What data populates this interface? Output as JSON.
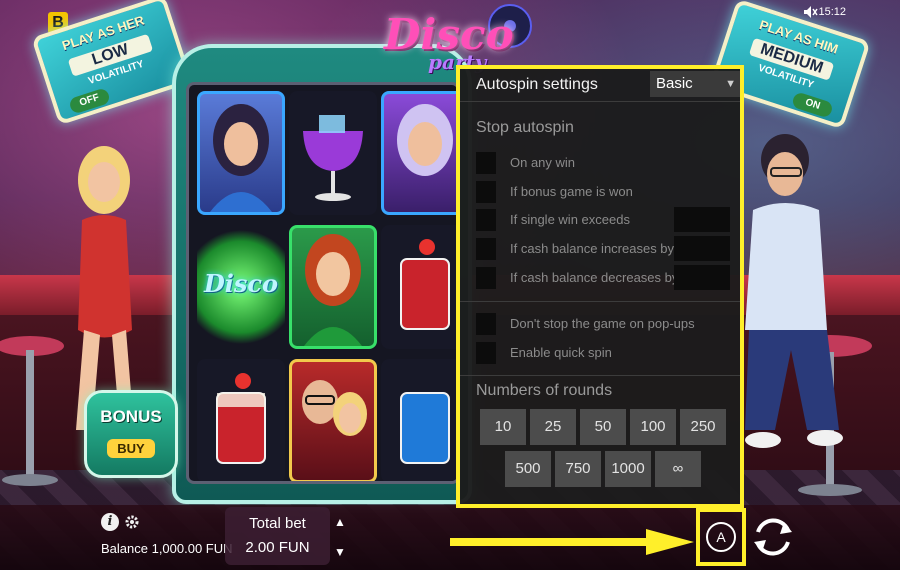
{
  "brand": {
    "badge": "B"
  },
  "status_bar": {
    "time": "15:12",
    "speaker_icon": "speaker-muted-icon"
  },
  "logo": {
    "title": "Disco",
    "subtitle": "party"
  },
  "banner_left": {
    "top": "PLAY AS HER",
    "volatility": "LOW",
    "sub": "VOLATILITY",
    "toggle": "OFF"
  },
  "banner_right": {
    "top": "PLAY AS HIM",
    "volatility": "MEDIUM",
    "sub": "VOLATILITY",
    "toggle": "ON"
  },
  "reels": {
    "disco_symbol": "Disco"
  },
  "bonus_buy": {
    "line1": "BONUS",
    "line2": "BUY"
  },
  "footer": {
    "info_icon": "i",
    "balance": "Balance 1,000.00 FUN",
    "total_bet_label": "Total bet",
    "total_bet_value": "2.00 FUN",
    "bet_up": "▲",
    "bet_down": "▼",
    "autospin_label": "A"
  },
  "autospin_panel": {
    "title": "Autospin settings",
    "mode": "Basic",
    "stop_autospin": "Stop autospin",
    "options": [
      "On any win",
      "If bonus game is won",
      "If single win exceeds",
      "If cash balance increases by",
      "If cash balance decreases by"
    ],
    "extra_options": [
      "Don't stop the game on pop-ups",
      "Enable quick spin"
    ],
    "rounds_label": "Numbers of rounds",
    "rounds_row1": [
      "10",
      "25",
      "50",
      "100",
      "250"
    ],
    "rounds_row2": [
      "500",
      "750",
      "1000",
      "∞"
    ]
  },
  "colors": {
    "highlight": "#ffef2a",
    "panel_bg": "#1c1c1c",
    "round_btn": "#4c4c4c"
  }
}
